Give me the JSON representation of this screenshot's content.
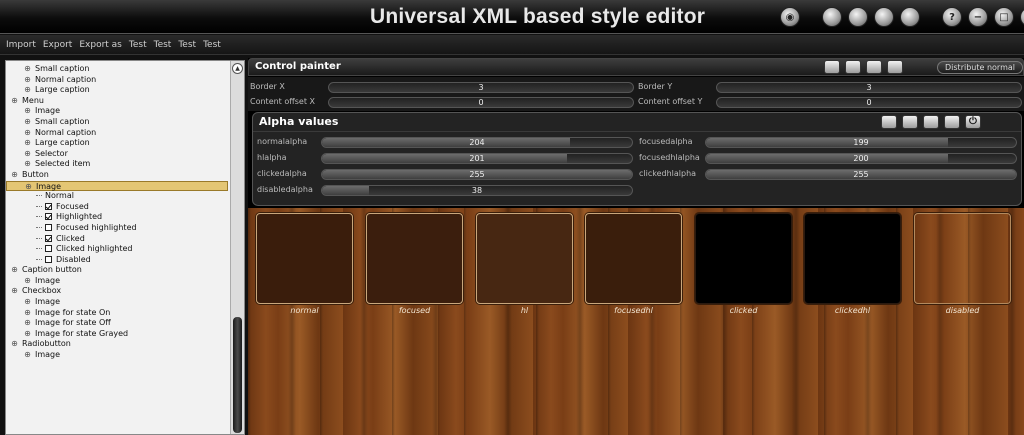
{
  "app": {
    "title": "Universal XML based style editor"
  },
  "title_buttons": [
    {
      "icon": "eye-icon"
    },
    {
      "icon": "copy-icon"
    },
    {
      "icon": "paste-icon"
    },
    {
      "icon": "open-folder-icon"
    },
    {
      "icon": "save-icon"
    },
    {
      "icon": "help-icon",
      "glyph": "?"
    },
    {
      "icon": "minimize-icon",
      "glyph": "−"
    },
    {
      "icon": "maximize-icon",
      "glyph": "□"
    },
    {
      "icon": "close-icon",
      "glyph": "✕"
    }
  ],
  "menu": [
    "Import",
    "Export",
    "Export as",
    "Test",
    "Test",
    "Test",
    "Test"
  ],
  "tree": [
    {
      "label": "Small caption",
      "depth": 1,
      "kind": "node"
    },
    {
      "label": "Normal caption",
      "depth": 1,
      "kind": "node"
    },
    {
      "label": "Large caption",
      "depth": 1,
      "kind": "node"
    },
    {
      "label": "Menu",
      "depth": 0,
      "kind": "node"
    },
    {
      "label": "Image",
      "depth": 1,
      "kind": "node"
    },
    {
      "label": "Small caption",
      "depth": 1,
      "kind": "node"
    },
    {
      "label": "Normal caption",
      "depth": 1,
      "kind": "node"
    },
    {
      "label": "Large caption",
      "depth": 1,
      "kind": "node"
    },
    {
      "label": "Selector",
      "depth": 1,
      "kind": "node"
    },
    {
      "label": "Selected item",
      "depth": 1,
      "kind": "node"
    },
    {
      "label": "Button",
      "depth": 0,
      "kind": "node"
    },
    {
      "label": "Image",
      "depth": 1,
      "kind": "node",
      "selected": true
    },
    {
      "label": "Normal",
      "depth": 2,
      "kind": "leaf"
    },
    {
      "label": "Focused",
      "depth": 2,
      "kind": "check",
      "checked": true
    },
    {
      "label": "Highlighted",
      "depth": 2,
      "kind": "check",
      "checked": true
    },
    {
      "label": "Focused highlighted",
      "depth": 2,
      "kind": "check",
      "checked": false
    },
    {
      "label": "Clicked",
      "depth": 2,
      "kind": "check",
      "checked": true
    },
    {
      "label": "Clicked highlighted",
      "depth": 2,
      "kind": "check",
      "checked": false
    },
    {
      "label": "Disabled",
      "depth": 2,
      "kind": "check",
      "checked": false
    },
    {
      "label": "Caption button",
      "depth": 0,
      "kind": "node"
    },
    {
      "label": "Image",
      "depth": 1,
      "kind": "node"
    },
    {
      "label": "Checkbox",
      "depth": 0,
      "kind": "node"
    },
    {
      "label": "Image",
      "depth": 1,
      "kind": "node"
    },
    {
      "label": "Image for state On",
      "depth": 1,
      "kind": "node"
    },
    {
      "label": "Image for state Off",
      "depth": 1,
      "kind": "node"
    },
    {
      "label": "Image for state Grayed",
      "depth": 1,
      "kind": "node"
    },
    {
      "label": "Radiobutton",
      "depth": 0,
      "kind": "node"
    },
    {
      "label": "Image",
      "depth": 1,
      "kind": "node"
    }
  ],
  "control_painter": {
    "title": "Control painter",
    "distribute_label": "Distribute normal",
    "fields": {
      "border_x": {
        "label": "Border X",
        "value": "3",
        "fraction": 0.0
      },
      "border_y": {
        "label": "Border Y",
        "value": "3",
        "fraction": 0.0
      },
      "content_offset_x": {
        "label": "Content offset X",
        "value": "0",
        "fraction": 0.0
      },
      "content_offset_y": {
        "label": "Content offset Y",
        "value": "0",
        "fraction": 0.0
      }
    }
  },
  "alpha_values": {
    "title": "Alpha values",
    "fields": {
      "normalalpha": {
        "label": "normalalpha",
        "value": "204",
        "fraction": 0.8
      },
      "hlalpha": {
        "label": "hlalpha",
        "value": "201",
        "fraction": 0.79
      },
      "clickedalpha": {
        "label": "clickedalpha",
        "value": "255",
        "fraction": 1.0
      },
      "disabledalpha": {
        "label": "disabledalpha",
        "value": "38",
        "fraction": 0.15
      },
      "focusedalpha": {
        "label": "focusedalpha",
        "value": "199",
        "fraction": 0.78
      },
      "focusedhlalpha": {
        "label": "focusedhlalpha",
        "value": "200",
        "fraction": 0.78
      },
      "clickedhlalpha": {
        "label": "clickedhlalpha",
        "value": "255",
        "fraction": 1.0
      }
    }
  },
  "previews": [
    {
      "label": "normal",
      "color": "#3a1d0c"
    },
    {
      "label": "focused",
      "color": "#3b1e0d"
    },
    {
      "label": "hl",
      "color": "#472712"
    },
    {
      "label": "focusedhl",
      "color": "#3a1e0c"
    },
    {
      "label": "clicked",
      "color": "#000000"
    },
    {
      "label": "clickedhl",
      "color": "#000000"
    },
    {
      "label": "disabled",
      "color": "#8a4a1e"
    }
  ]
}
